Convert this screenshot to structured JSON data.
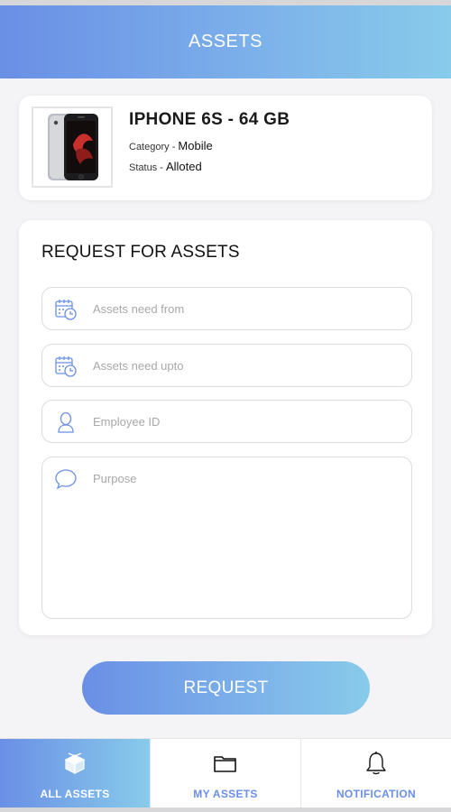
{
  "header": {
    "title": "ASSETS"
  },
  "asset": {
    "image_icon": "iphone-product-image",
    "name": "IPHONE 6S - 64 GB",
    "category_label": "Category - ",
    "category_value": "Mobile",
    "status_label": "Status - ",
    "status_value": "Alloted"
  },
  "form": {
    "title": "REQUEST FOR ASSETS",
    "fields": [
      {
        "icon": "calendar-clock-icon",
        "placeholder": "Assets need from"
      },
      {
        "icon": "calendar-clock-icon",
        "placeholder": "Assets need upto"
      },
      {
        "icon": "user-icon",
        "placeholder": "Employee ID"
      },
      {
        "icon": "chat-bubble-icon",
        "placeholder": "Purpose"
      }
    ]
  },
  "request_button": {
    "label": "REQUEST"
  },
  "bottom_nav": {
    "items": [
      {
        "label": "ALL ASSETS",
        "icon": "box-icon",
        "active": true
      },
      {
        "label": "MY ASSETS",
        "icon": "folder-icon",
        "active": false
      },
      {
        "label": "NOTIFICATION",
        "icon": "bell-icon",
        "active": false
      }
    ]
  },
  "colors": {
    "accent": "#6a8fe6",
    "accent_light": "#88cbea"
  }
}
